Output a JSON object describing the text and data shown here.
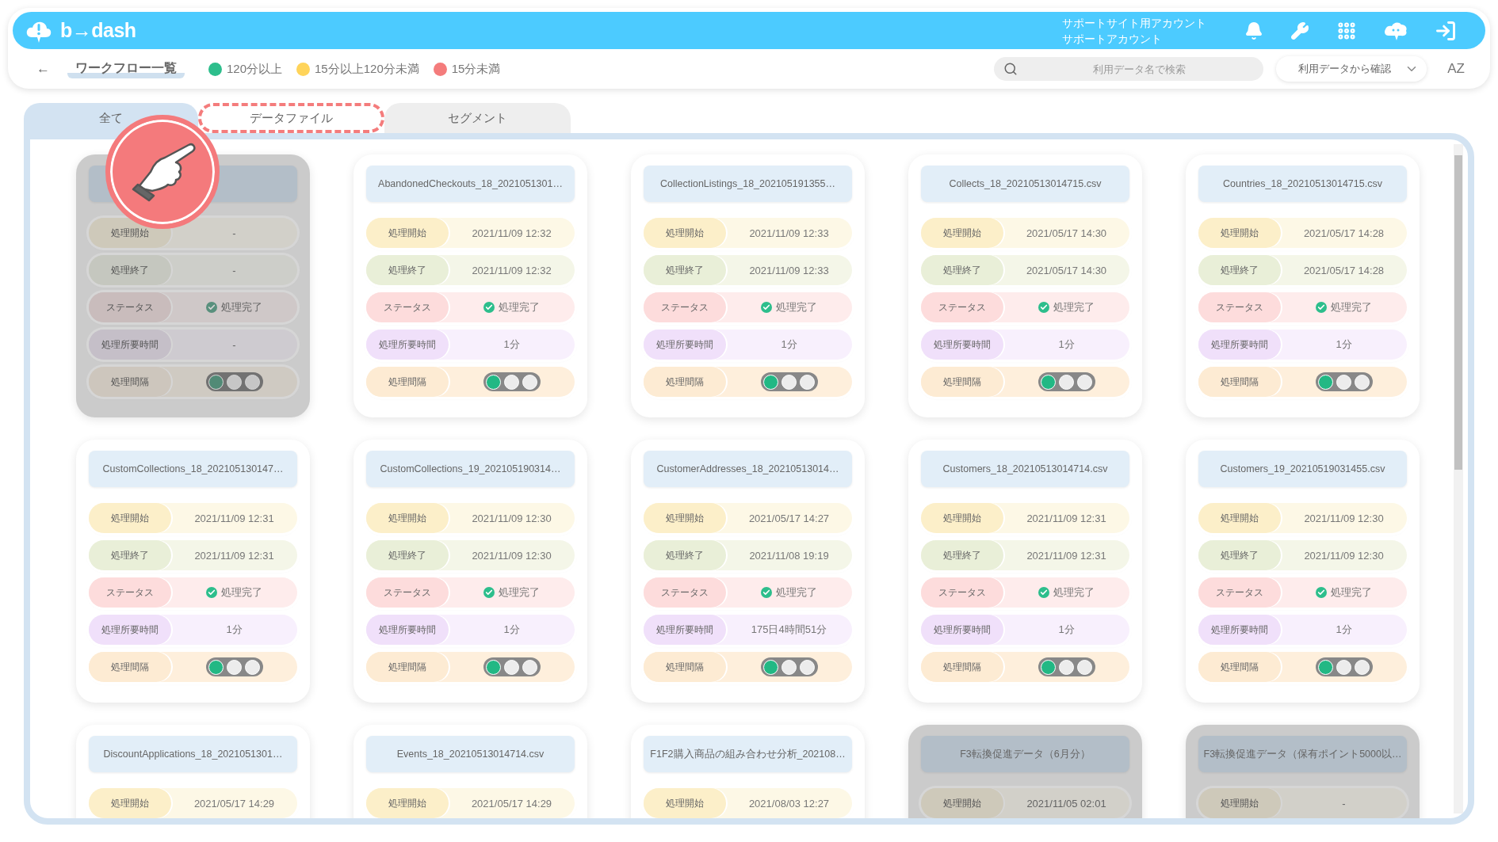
{
  "header": {
    "logo": "b→dash",
    "account": [
      "サポートサイト用アカウント",
      "サポートアカウント"
    ]
  },
  "toolbar": {
    "back": "←",
    "title": "ワークフロー一覧",
    "legend": [
      {
        "label": "120分以上",
        "color": "#2dbe8c"
      },
      {
        "label": "15分以上120分未満",
        "color": "#ffd45a"
      },
      {
        "label": "15分未満",
        "color": "#f47c7c"
      }
    ],
    "search": {
      "placeholder": "利用データ名で検索"
    },
    "filter": "利用データから確認",
    "sort": "AZ"
  },
  "tabs": [
    {
      "label": "全て",
      "selected": true,
      "highlighted": false
    },
    {
      "label": "データファイル",
      "selected": false,
      "highlighted": true
    },
    {
      "label": "セグメント",
      "selected": false,
      "highlighted": false
    }
  ],
  "cards": [
    {
      "disabled": true,
      "rows": [
        {
          "kind": "start",
          "label": "処理開始",
          "value": "-"
        },
        {
          "kind": "end",
          "label": "処理終了",
          "value": "-"
        },
        {
          "kind": "status",
          "label": "ステータス",
          "value": "処理完了",
          "done": true
        },
        {
          "kind": "duration",
          "label": "処理所要時間",
          "value": "-"
        },
        {
          "kind": "interval",
          "label": "処理間隔",
          "dots": [
            {
              "on": true
            },
            {
              "on": false
            },
            {
              "on": false
            }
          ]
        }
      ]
    },
    {
      "disabled": false,
      "title": "AbandonedCheckouts_18_2021051301…",
      "rows": [
        {
          "kind": "start",
          "label": "処理開始",
          "value": "2021/11/09 12:32"
        },
        {
          "kind": "end",
          "label": "処理終了",
          "value": "2021/11/09 12:32"
        },
        {
          "kind": "status",
          "label": "ステータス",
          "value": "処理完了",
          "done": true
        },
        {
          "kind": "duration",
          "label": "処理所要時間",
          "value": "1分"
        },
        {
          "kind": "interval",
          "label": "処理間隔",
          "dots": [
            {
              "on": true
            },
            {
              "on": false
            },
            {
              "on": false
            }
          ]
        }
      ]
    },
    {
      "disabled": false,
      "title": "CollectionListings_18_202105191355…",
      "rows": [
        {
          "kind": "start",
          "label": "処理開始",
          "value": "2021/11/09 12:33"
        },
        {
          "kind": "end",
          "label": "処理終了",
          "value": "2021/11/09 12:33"
        },
        {
          "kind": "status",
          "label": "ステータス",
          "value": "処理完了",
          "done": true
        },
        {
          "kind": "duration",
          "label": "処理所要時間",
          "value": "1分"
        },
        {
          "kind": "interval",
          "label": "処理間隔",
          "dots": [
            {
              "on": true
            },
            {
              "on": false
            },
            {
              "on": false
            }
          ]
        }
      ]
    },
    {
      "disabled": false,
      "title": "Collects_18_20210513014715.csv",
      "rows": [
        {
          "kind": "start",
          "label": "処理開始",
          "value": "2021/05/17 14:30"
        },
        {
          "kind": "end",
          "label": "処理終了",
          "value": "2021/05/17 14:30"
        },
        {
          "kind": "status",
          "label": "ステータス",
          "value": "処理完了",
          "done": true
        },
        {
          "kind": "duration",
          "label": "処理所要時間",
          "value": "1分"
        },
        {
          "kind": "interval",
          "label": "処理間隔",
          "dots": [
            {
              "on": true
            },
            {
              "on": false
            },
            {
              "on": false
            }
          ]
        }
      ]
    },
    {
      "disabled": false,
      "title": "Countries_18_20210513014715.csv",
      "rows": [
        {
          "kind": "start",
          "label": "処理開始",
          "value": "2021/05/17 14:28"
        },
        {
          "kind": "end",
          "label": "処理終了",
          "value": "2021/05/17 14:28"
        },
        {
          "kind": "status",
          "label": "ステータス",
          "value": "処理完了",
          "done": true
        },
        {
          "kind": "duration",
          "label": "処理所要時間",
          "value": "1分"
        },
        {
          "kind": "interval",
          "label": "処理間隔",
          "dots": [
            {
              "on": true
            },
            {
              "on": false
            },
            {
              "on": false
            }
          ]
        }
      ]
    },
    {
      "disabled": false,
      "title": "CustomCollections_18_202105130147…",
      "rows": [
        {
          "kind": "start",
          "label": "処理開始",
          "value": "2021/11/09 12:31"
        },
        {
          "kind": "end",
          "label": "処理終了",
          "value": "2021/11/09 12:31"
        },
        {
          "kind": "status",
          "label": "ステータス",
          "value": "処理完了",
          "done": true
        },
        {
          "kind": "duration",
          "label": "処理所要時間",
          "value": "1分"
        },
        {
          "kind": "interval",
          "label": "処理間隔",
          "dots": [
            {
              "on": true
            },
            {
              "on": false
            },
            {
              "on": false
            }
          ]
        }
      ]
    },
    {
      "disabled": false,
      "title": "CustomCollections_19_202105190314…",
      "rows": [
        {
          "kind": "start",
          "label": "処理開始",
          "value": "2021/11/09 12:30"
        },
        {
          "kind": "end",
          "label": "処理終了",
          "value": "2021/11/09 12:30"
        },
        {
          "kind": "status",
          "label": "ステータス",
          "value": "処理完了",
          "done": true
        },
        {
          "kind": "duration",
          "label": "処理所要時間",
          "value": "1分"
        },
        {
          "kind": "interval",
          "label": "処理間隔",
          "dots": [
            {
              "on": true
            },
            {
              "on": false
            },
            {
              "on": false
            }
          ]
        }
      ]
    },
    {
      "disabled": false,
      "title": "CustomerAddresses_18_20210513014…",
      "rows": [
        {
          "kind": "start",
          "label": "処理開始",
          "value": "2021/05/17 14:27"
        },
        {
          "kind": "end",
          "label": "処理終了",
          "value": "2021/11/08 19:19"
        },
        {
          "kind": "status",
          "label": "ステータス",
          "value": "処理完了",
          "done": true
        },
        {
          "kind": "duration",
          "label": "処理所要時間",
          "value": "175日4時間51分"
        },
        {
          "kind": "interval",
          "label": "処理間隔",
          "dots": [
            {
              "on": true
            },
            {
              "on": false
            },
            {
              "on": false
            }
          ]
        }
      ]
    },
    {
      "disabled": false,
      "title": "Customers_18_20210513014714.csv",
      "rows": [
        {
          "kind": "start",
          "label": "処理開始",
          "value": "2021/11/09 12:31"
        },
        {
          "kind": "end",
          "label": "処理終了",
          "value": "2021/11/09 12:31"
        },
        {
          "kind": "status",
          "label": "ステータス",
          "value": "処理完了",
          "done": true
        },
        {
          "kind": "duration",
          "label": "処理所要時間",
          "value": "1分"
        },
        {
          "kind": "interval",
          "label": "処理間隔",
          "dots": [
            {
              "on": true
            },
            {
              "on": false
            },
            {
              "on": false
            }
          ]
        }
      ]
    },
    {
      "disabled": false,
      "title": "Customers_19_20210519031455.csv",
      "rows": [
        {
          "kind": "start",
          "label": "処理開始",
          "value": "2021/11/09 12:30"
        },
        {
          "kind": "end",
          "label": "処理終了",
          "value": "2021/11/09 12:30"
        },
        {
          "kind": "status",
          "label": "ステータス",
          "value": "処理完了",
          "done": true
        },
        {
          "kind": "duration",
          "label": "処理所要時間",
          "value": "1分"
        },
        {
          "kind": "interval",
          "label": "処理間隔",
          "dots": [
            {
              "on": true
            },
            {
              "on": false
            },
            {
              "on": false
            }
          ]
        }
      ]
    },
    {
      "disabled": false,
      "title": "DiscountApplications_18_2021051301…",
      "rows": [
        {
          "kind": "start",
          "label": "処理開始",
          "value": "2021/05/17 14:29"
        }
      ]
    },
    {
      "disabled": false,
      "title": "Events_18_20210513014714.csv",
      "rows": [
        {
          "kind": "start",
          "label": "処理開始",
          "value": "2021/05/17 14:29"
        }
      ]
    },
    {
      "disabled": false,
      "title": "F1F2購入商品の組み合わせ分析_202108…",
      "rows": [
        {
          "kind": "start",
          "label": "処理開始",
          "value": "2021/08/03 12:27"
        }
      ]
    },
    {
      "disabled": true,
      "title": "F3転換促進データ（6月分）",
      "rows": [
        {
          "kind": "start",
          "label": "処理開始",
          "value": "2021/11/05 02:01"
        }
      ]
    },
    {
      "disabled": true,
      "title": "F3転換促進データ（保有ポイント5000以…",
      "rows": [
        {
          "kind": "start",
          "label": "処理開始",
          "value": "-"
        }
      ]
    }
  ]
}
